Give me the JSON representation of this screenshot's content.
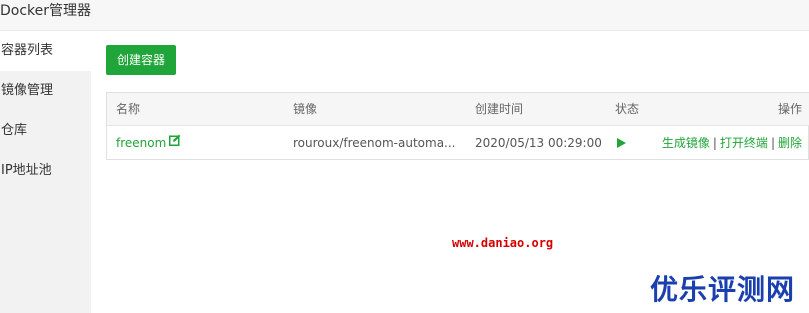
{
  "app": {
    "title": "Docker管理器"
  },
  "sidebar": {
    "items": [
      {
        "label": "容器列表",
        "active": true
      },
      {
        "label": "镜像管理",
        "active": false
      },
      {
        "label": "仓库",
        "active": false
      },
      {
        "label": "IP地址池",
        "active": false
      }
    ]
  },
  "toolbar": {
    "create_label": "创建容器"
  },
  "table": {
    "headers": {
      "name": "名称",
      "image": "镜像",
      "created": "创建时间",
      "status": "状态",
      "actions": "操作"
    },
    "rows": [
      {
        "name": "freenom",
        "image": "rouroux/freenom-automa...",
        "created": "2020/05/13 00:29:00",
        "status_icon": "play-icon",
        "actions": [
          "生成镜像",
          "打开终端",
          "删除"
        ]
      }
    ]
  },
  "watermark": {
    "url": "www.daniao.org",
    "brand": "优乐评测网"
  },
  "colors": {
    "accent": "#20a53a",
    "sidebar_bg": "#f2f2f2",
    "header_bg": "#f7f7f7",
    "watermark_url": "#d40000",
    "watermark_brand": "#1a3fae"
  }
}
